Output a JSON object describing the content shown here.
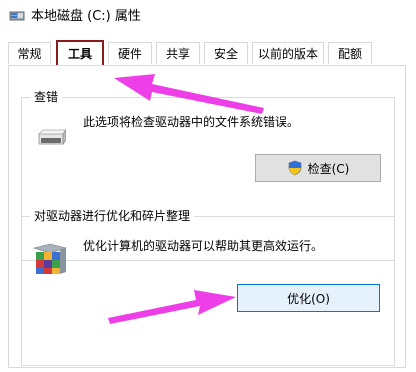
{
  "window": {
    "title": "本地磁盘 (C:) 属性",
    "icon": "drive-icon"
  },
  "tabs": [
    {
      "label": "常规",
      "active": false
    },
    {
      "label": "工具",
      "active": true
    },
    {
      "label": "硬件",
      "active": false
    },
    {
      "label": "共享",
      "active": false
    },
    {
      "label": "安全",
      "active": false
    },
    {
      "label": "以前的版本",
      "active": false
    },
    {
      "label": "配额",
      "active": false
    }
  ],
  "check_section": {
    "title": "查错",
    "description": "此选项将检查驱动器中的文件系统错误。",
    "button_label": "检查(C)",
    "icon": "drive-icon",
    "button_icon": "uac-shield-icon"
  },
  "optimize_section": {
    "title": "对驱动器进行优化和碎片整理",
    "description": "优化计算机的驱动器可以帮助其更高效运行。",
    "button_label": "优化(O)",
    "icon": "defrag-icon"
  },
  "annotations": {
    "arrow_color": "#ee3ee8",
    "highlight_color": "#8b1a1a"
  }
}
